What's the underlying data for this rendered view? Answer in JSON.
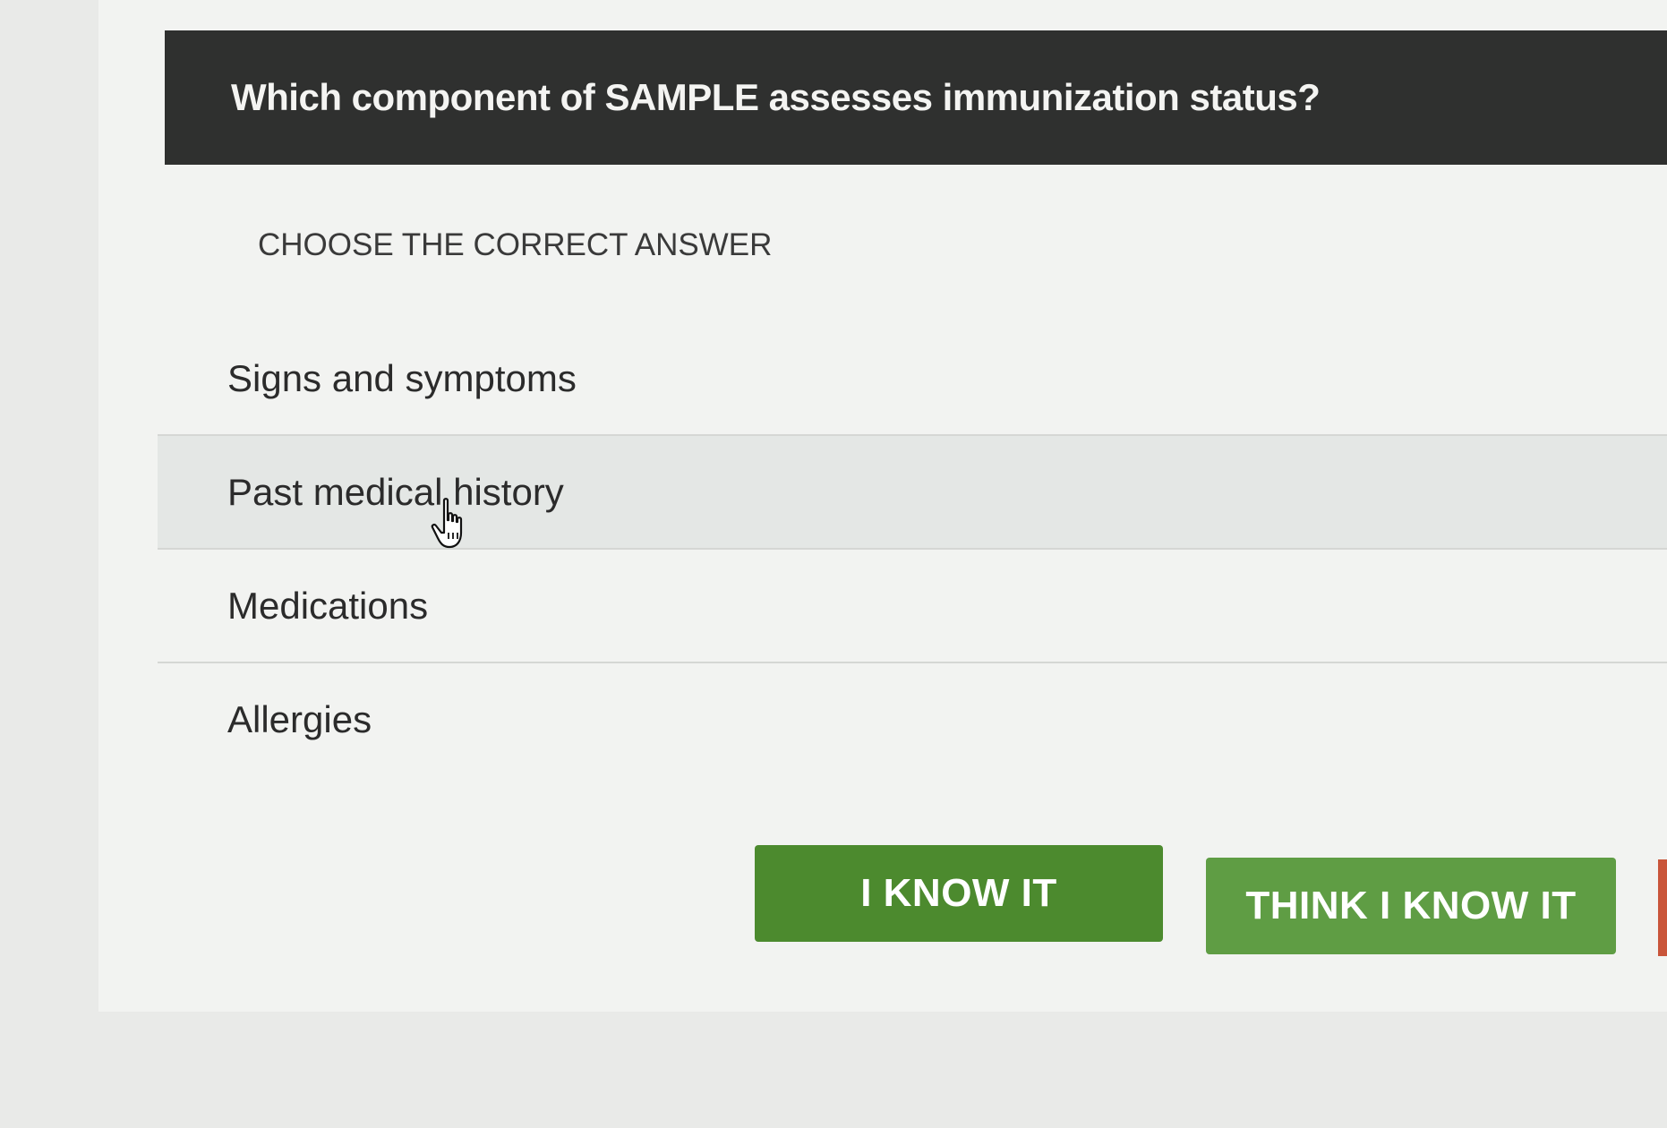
{
  "question": {
    "text": "Which component of SAMPLE assesses immunization status?"
  },
  "instruction": "CHOOSE THE CORRECT ANSWER",
  "options": [
    {
      "label": "Signs and symptoms"
    },
    {
      "label": "Past medical history"
    },
    {
      "label": "Medications"
    },
    {
      "label": "Allergies"
    }
  ],
  "buttons": {
    "know_it": "I KNOW IT",
    "think_know_it": "THINK I KNOW IT"
  },
  "colors": {
    "question_bar": "#2f302f",
    "know_button": "#4c8a2e",
    "think_button": "#5f9d44"
  },
  "cursor": {
    "icon": "hand-pointer-icon"
  }
}
